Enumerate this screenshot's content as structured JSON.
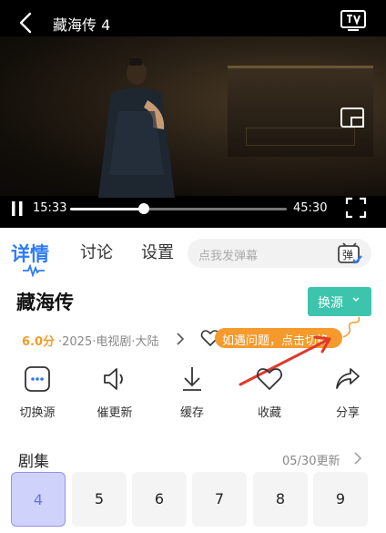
{
  "player": {
    "title": "藏海传 4",
    "current_time": "15:33",
    "total_time": "45:30",
    "progress": 0.342,
    "icons": [
      "back-arrow-icon",
      "tv-cast-icon",
      "picture-in-picture-icon",
      "pause-icon",
      "fullscreen-icon"
    ]
  },
  "tabs": {
    "detail": "详情",
    "discuss": "讨论",
    "settings": "设置",
    "danmaku_placeholder": "点我发弹幕",
    "danmaku_toggle": "弹"
  },
  "show": {
    "title": "藏海传",
    "switch_source": "换源",
    "score": "6.0分",
    "meta": "·2025·电视剧·大陆",
    "tooltip": "如遇问题，点击切换"
  },
  "actions": [
    {
      "label": "切换源",
      "icon": "more-dots-icon"
    },
    {
      "label": "催更新",
      "icon": "speaker-icon"
    },
    {
      "label": "缓存",
      "icon": "download-icon"
    },
    {
      "label": "收藏",
      "icon": "heart-icon"
    },
    {
      "label": "分享",
      "icon": "share-icon"
    }
  ],
  "episodes": {
    "heading": "剧集",
    "update_status": "05/30更新",
    "items": [
      "4",
      "5",
      "6",
      "7",
      "8",
      "9"
    ],
    "active_index": 0
  },
  "colors": {
    "accent_blue": "#2f7cf6",
    "source_button": "#3cc4ad",
    "score_orange": "#f39b2a",
    "tooltip_orange": "#f59a2c",
    "hint_arrow_red": "#e0382b",
    "episode_active": "#cfd3fb"
  }
}
